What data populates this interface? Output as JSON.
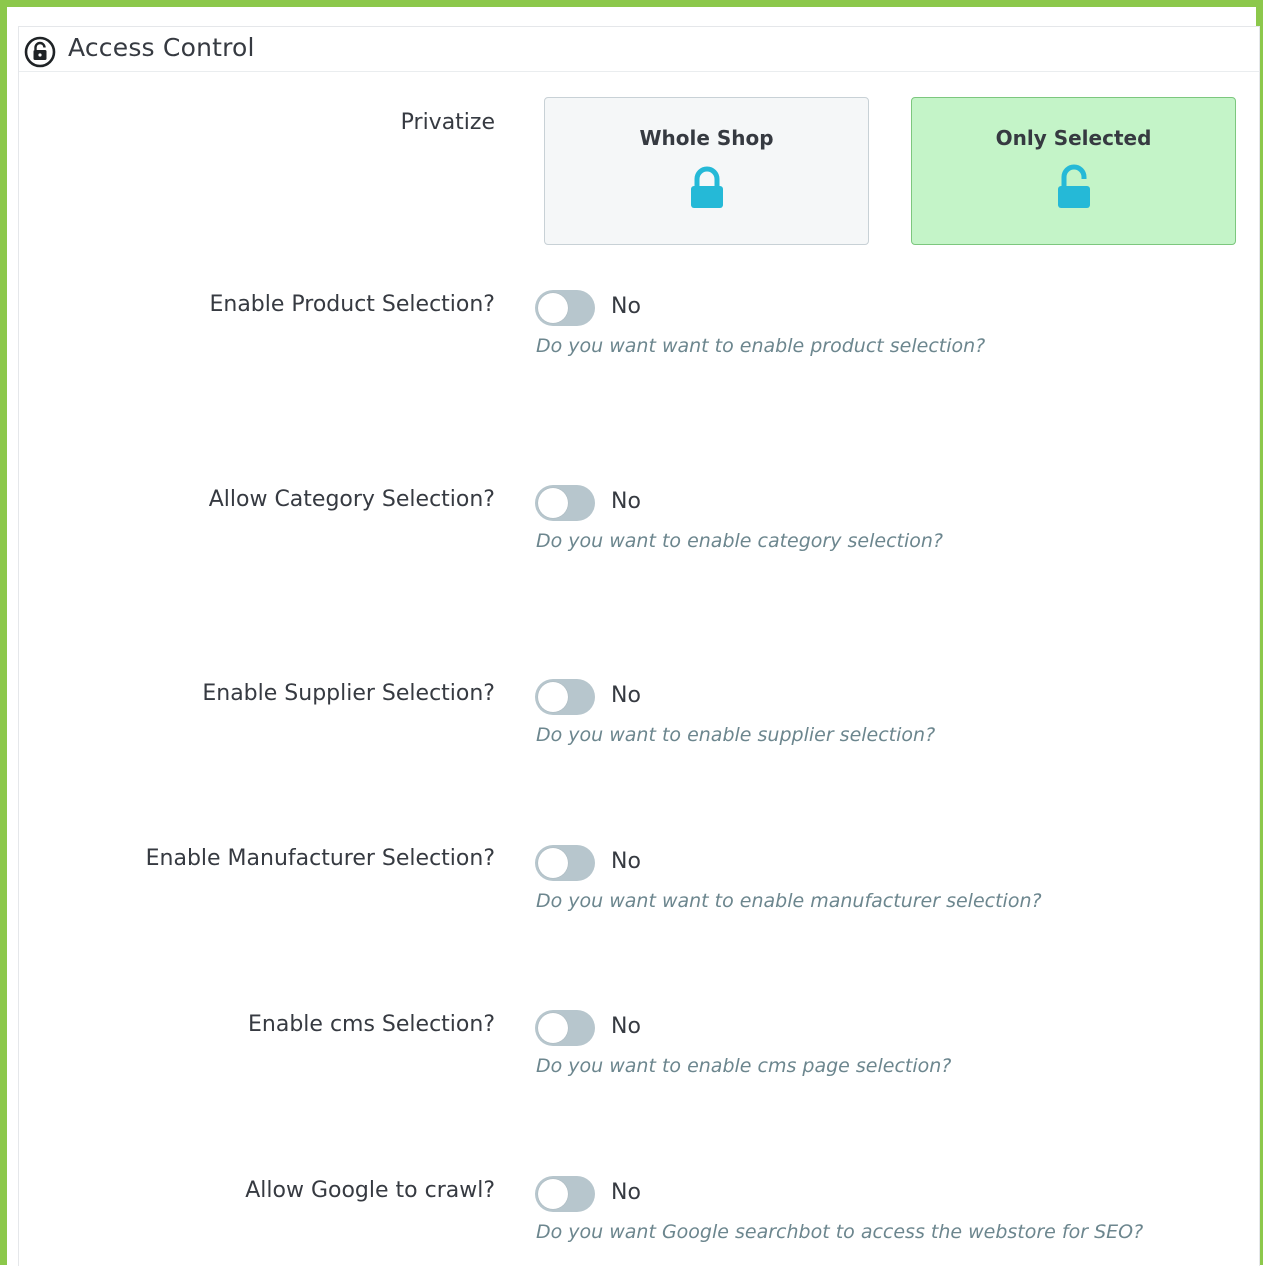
{
  "panel": {
    "title": "Access Control",
    "title_icon": "lock-circle-icon"
  },
  "privatize": {
    "label": "Privatize",
    "options": [
      {
        "label": "Whole Shop",
        "icon": "lock-closed-icon",
        "selected": false
      },
      {
        "label": "Only Selected",
        "icon": "lock-open-icon",
        "selected": true
      }
    ]
  },
  "settings": [
    {
      "label": "Enable Product Selection?",
      "state": "No",
      "help": "Do you want want to enable product selection?"
    },
    {
      "label": "Allow Category Selection?",
      "state": "No",
      "help": "Do you want to enable category selection?"
    },
    {
      "label": "Enable Supplier Selection?",
      "state": "No",
      "help": "Do you want to enable supplier selection?"
    },
    {
      "label": "Enable Manufacturer Selection?",
      "state": "No",
      "help": "Do you want want to enable manufacturer selection?"
    },
    {
      "label": "Enable cms Selection?",
      "state": "No",
      "help": "Do you want to enable cms page selection?"
    },
    {
      "label": "Allow Google to crawl?",
      "state": "No",
      "help": "Do you want Google searchbot to access the webstore for SEO?"
    }
  ],
  "colors": {
    "frame_border": "#8cc84b",
    "lock_icon": "#25b9d7",
    "selected_option_bg": "#c4f4c8",
    "toggle_off": "#b7c6cd"
  }
}
